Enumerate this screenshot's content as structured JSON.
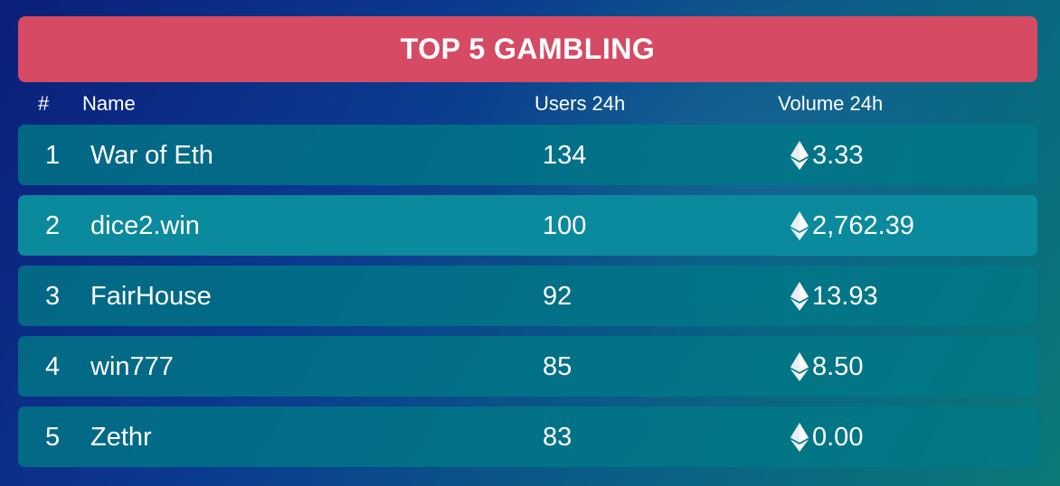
{
  "header": {
    "title": "TOP 5 GAMBLING",
    "color": "#d64a63"
  },
  "columns": {
    "rank": "#",
    "name": "Name",
    "users": "Users 24h",
    "volume": "Volume 24h"
  },
  "rows": [
    {
      "rank": "1",
      "name": "War of Eth",
      "users": "134",
      "volume": "3.33",
      "currency_icon": "ethereum-icon"
    },
    {
      "rank": "2",
      "name": "dice2.win",
      "users": "100",
      "volume": "2,762.39",
      "currency_icon": "ethereum-icon"
    },
    {
      "rank": "3",
      "name": "FairHouse",
      "users": "92",
      "volume": "13.93",
      "currency_icon": "ethereum-icon"
    },
    {
      "rank": "4",
      "name": "win777",
      "users": "85",
      "volume": "8.50",
      "currency_icon": "ethereum-icon"
    },
    {
      "rank": "5",
      "name": "Zethr",
      "users": "83",
      "volume": "0.00",
      "currency_icon": "ethereum-icon"
    }
  ]
}
